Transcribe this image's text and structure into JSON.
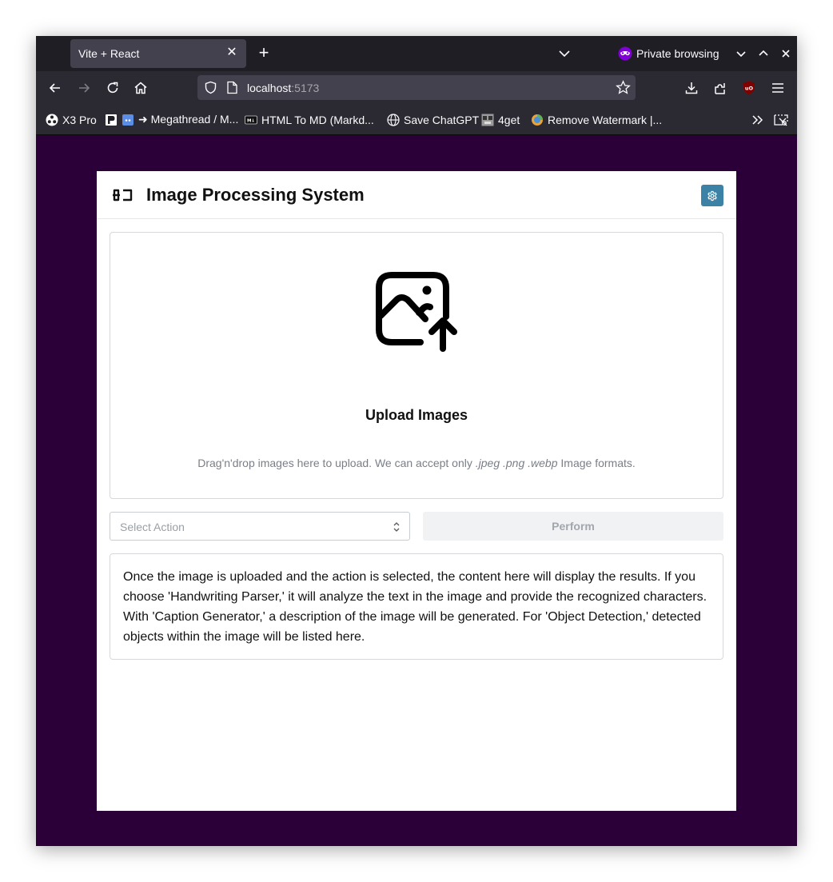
{
  "browser": {
    "tab": {
      "title": "Vite + React"
    },
    "private_label": "Private browsing",
    "url": {
      "host": "localhost",
      "port": ":5173"
    },
    "bookmarks": [
      {
        "label": "X3 Pro"
      },
      {
        "label": "➜ Megathread / M..."
      },
      {
        "label": "HTML To MD (Markd..."
      },
      {
        "label": "Save ChatGPT"
      },
      {
        "label": "4get"
      },
      {
        "label": "Remove Watermark |..."
      }
    ]
  },
  "app": {
    "title": "Image Processing System",
    "accent_color": "#3b82a6",
    "page_background": "#2b0039",
    "dropzone": {
      "title": "Upload Images",
      "hint_prefix": "Drag'n'drop images here to upload. We can accept only",
      "formats": ".jpeg .png .webp",
      "hint_suffix": "Image formats."
    },
    "action_select": {
      "placeholder": "Select Action"
    },
    "perform_label": "Perform",
    "results_text": "Once the image is uploaded and the action is selected, the content here will display the results. If you choose 'Handwriting Parser,' it will analyze the text in the image and provide the recognized characters. With 'Caption Generator,' a description of the image will be generated. For 'Object Detection,' detected objects within the image will be listed here."
  }
}
